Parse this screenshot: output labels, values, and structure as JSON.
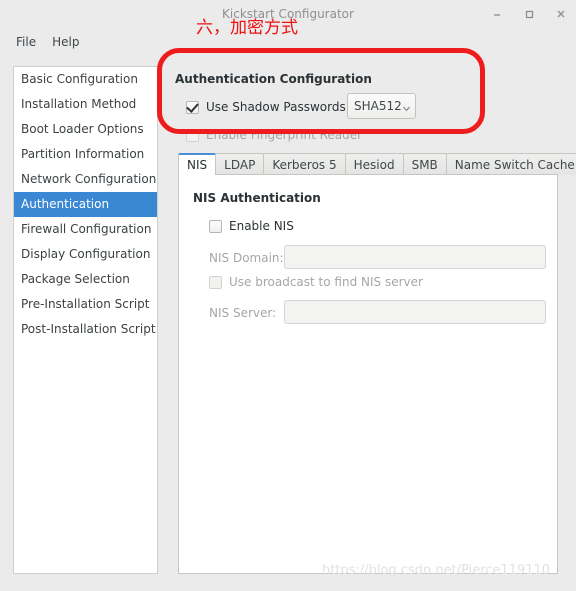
{
  "window": {
    "title": "Kickstart Configurator",
    "minimize_label": "–",
    "maximize_label": "□",
    "close_label": "×"
  },
  "menubar": {
    "items": [
      {
        "label": "File"
      },
      {
        "label": "Help"
      }
    ]
  },
  "sidebar": {
    "items": [
      {
        "label": "Basic Configuration",
        "selected": false
      },
      {
        "label": "Installation Method",
        "selected": false
      },
      {
        "label": "Boot Loader Options",
        "selected": false
      },
      {
        "label": "Partition Information",
        "selected": false
      },
      {
        "label": "Network Configuration",
        "selected": false
      },
      {
        "label": "Authentication",
        "selected": true
      },
      {
        "label": "Firewall Configuration",
        "selected": false
      },
      {
        "label": "Display Configuration",
        "selected": false
      },
      {
        "label": "Package Selection",
        "selected": false
      },
      {
        "label": "Pre-Installation Script",
        "selected": false
      },
      {
        "label": "Post-Installation Script",
        "selected": false
      }
    ]
  },
  "auth": {
    "heading": "Authentication Configuration",
    "shadow_passwords_label": "Use Shadow Passwords",
    "shadow_passwords_checked": true,
    "hash_algorithm": "SHA512",
    "fingerprint_label": "Enable Fingerprint Reader",
    "fingerprint_checked": false
  },
  "tabs": [
    {
      "label": "NIS",
      "active": true
    },
    {
      "label": "LDAP",
      "active": false
    },
    {
      "label": "Kerberos 5",
      "active": false
    },
    {
      "label": "Hesiod",
      "active": false
    },
    {
      "label": "SMB",
      "active": false
    },
    {
      "label": "Name Switch Cache",
      "active": false
    }
  ],
  "nis": {
    "heading": "NIS Authentication",
    "enable_label": "Enable NIS",
    "enable_checked": false,
    "domain_label": "NIS Domain:",
    "domain_value": "",
    "broadcast_label": "Use broadcast to find NIS server",
    "broadcast_checked": false,
    "server_label": "NIS Server:",
    "server_value": ""
  },
  "annotation": {
    "text": "六，加密方式",
    "color": "#f01010"
  },
  "watermark": {
    "text": "https://blog.csdn.net/Pierce119110"
  }
}
